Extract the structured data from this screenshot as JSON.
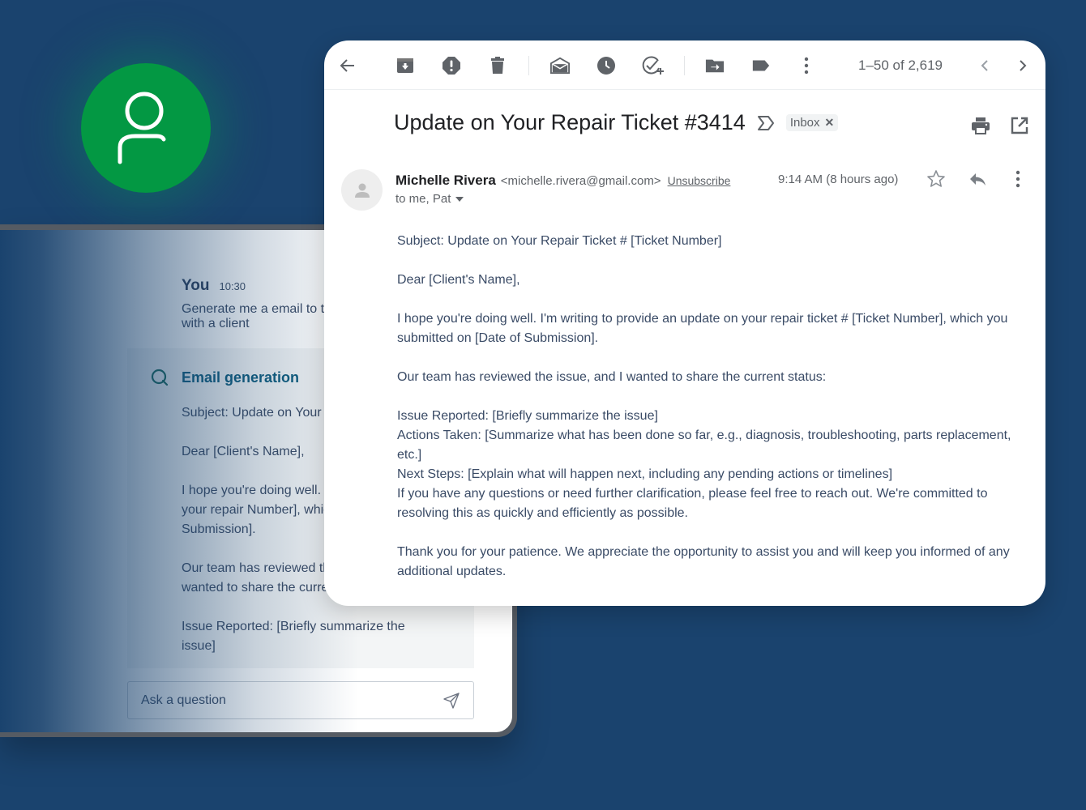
{
  "colors": {
    "background": "#1a436e",
    "avatar_green": "#039843",
    "ai_title_teal": "#0f5d7e",
    "body_text": "#3a4b66"
  },
  "avatar": {
    "icon": "user-icon"
  },
  "chat": {
    "user_name": "You",
    "user_time": "10:30",
    "user_message": "Generate me a email to t ticket with a client",
    "ai_icon": "search-loader-icon",
    "ai_title": "Email generation",
    "ai_paragraphs": [
      "Subject: Update on Your [Ticket Number]",
      "Dear [Client's Name],",
      "I hope you're doing well. an update on your repair Number], which you sub Submission].",
      "Our team has reviewed the issue, and I wanted to share the current status:",
      "Issue Reported: [Briefly summarize the issue]"
    ],
    "input_placeholder": "Ask a question",
    "send_icon": "send-icon"
  },
  "email": {
    "toolbar": {
      "icons": [
        "back-arrow-icon",
        "archive-icon",
        "report-spam-icon",
        "delete-icon",
        "mark-unread-icon",
        "snooze-icon",
        "add-task-icon",
        "move-to-icon",
        "label-icon",
        "more-vert-icon"
      ],
      "pager": "1–50 of 2,619",
      "prev_icon": "chevron-left-icon",
      "next_icon": "chevron-right-icon"
    },
    "subject": "Update on Your Repair Ticket #3414",
    "importance_icon": "importance-marker-icon",
    "label_chip": "Inbox",
    "sender": {
      "name": "Michelle Rivera",
      "email": "<michelle.rivera@gmail.com>",
      "unsubscribe": "Unsubscribe",
      "recipients": "to me, Pat",
      "time": "9:14 AM (8 hours ago)"
    },
    "body": [
      "Subject: Update on Your Repair Ticket # [Ticket Number]",
      "Dear [Client's Name],",
      "I hope you're doing well. I'm writing to provide an update on your repair ticket # [Ticket Number], which you submitted on [Date of Submission].",
      "Our team has reviewed the issue, and I wanted to share the current status:",
      "Issue Reported: [Briefly summarize the issue]",
      "Actions Taken: [Summarize what has been done so far, e.g., diagnosis, troubleshooting, parts replacement, etc.]",
      "Next Steps: [Explain what will happen next, including any pending actions or timelines]",
      "If you have any questions or need further clarification, please feel free to reach out. We're committed to resolving this as quickly and efficiently as possible.",
      "Thank you for your patience. We appreciate the opportunity to assist you and will keep you informed of any additional updates."
    ]
  }
}
